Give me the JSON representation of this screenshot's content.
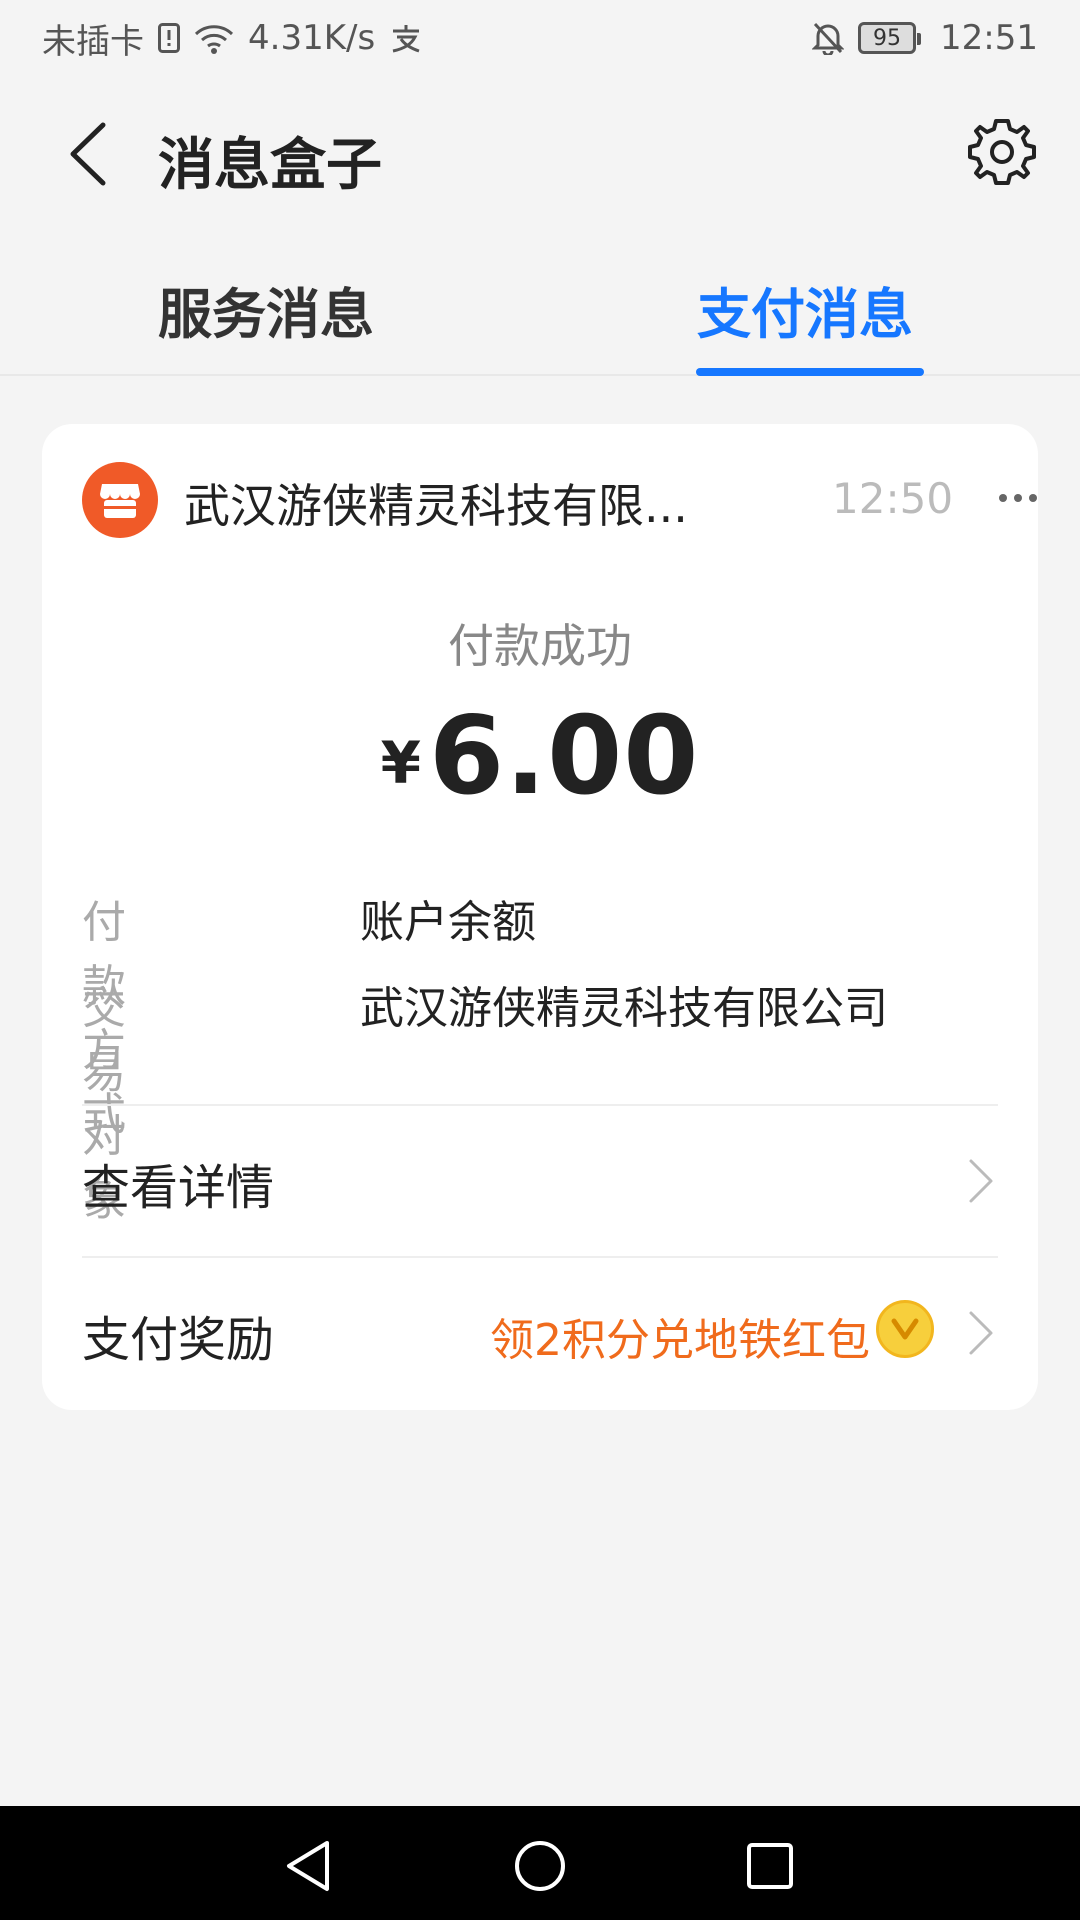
{
  "status_bar": {
    "carrier": "未插卡",
    "speed": "4.31K/s",
    "battery": "95",
    "time": "12:51"
  },
  "header": {
    "title": "消息盒子",
    "icons": {
      "back": "back-arrow-icon",
      "settings": "gear-icon"
    }
  },
  "tabs": [
    {
      "label": "服务消息",
      "active": false
    },
    {
      "label": "支付消息",
      "active": true
    }
  ],
  "card": {
    "merchant_name": "武汉游侠精灵科技有限...",
    "time": "12:50",
    "status": "付款成功",
    "currency": "¥",
    "amount": "6.00",
    "info": [
      {
        "label": "付款方式",
        "value": "账户余额"
      },
      {
        "label": "交易对象",
        "value": "武汉游侠精灵科技有限公司"
      }
    ],
    "actions": {
      "details_label": "查看详情",
      "reward_label": "支付奖励",
      "reward_text": "领2积分兑地铁红包"
    }
  },
  "colors": {
    "accent": "#1677ff",
    "merchant_logo": "#f05a28",
    "reward": "#f06b1c",
    "coin": "#f7cf3c"
  }
}
